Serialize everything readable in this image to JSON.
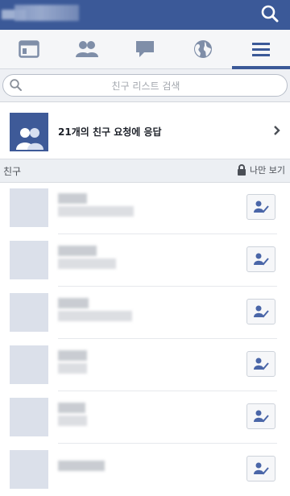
{
  "colors": {
    "brand": "#3b5998",
    "icon": "#7f8ea8",
    "avatar": "#dbe0ea"
  },
  "tabs": [
    {
      "id": "news-feed",
      "icon": "news-feed-icon",
      "active": false
    },
    {
      "id": "friend-requests",
      "icon": "friends-icon",
      "active": false
    },
    {
      "id": "messages",
      "icon": "chat-bubble-icon",
      "active": false
    },
    {
      "id": "notifications",
      "icon": "globe-icon",
      "active": false
    },
    {
      "id": "menu",
      "icon": "hamburger-menu-icon",
      "active": true
    }
  ],
  "search": {
    "placeholder": "친구 리스트 검색"
  },
  "friend_requests": {
    "label": "21개의 친구 요청에 응답"
  },
  "friends_section": {
    "title": "친구",
    "privacy_label": "나만 보기",
    "privacy_icon": "lock-icon"
  },
  "friends": [
    {
      "name": "",
      "subtitle": ""
    },
    {
      "name": "",
      "subtitle": ""
    },
    {
      "name": "",
      "subtitle": ""
    },
    {
      "name": "",
      "subtitle": ""
    },
    {
      "name": "",
      "subtitle": ""
    },
    {
      "name": "",
      "subtitle": ""
    }
  ]
}
